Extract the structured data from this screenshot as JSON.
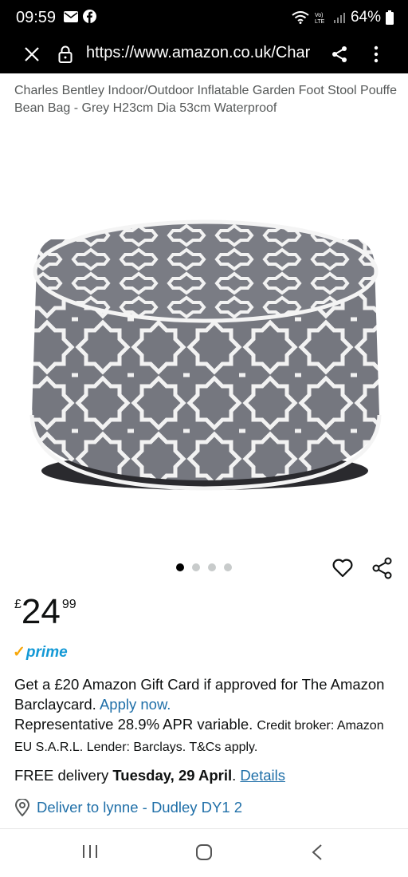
{
  "status": {
    "time": "09:59",
    "battery": "64%"
  },
  "browser": {
    "url": "https://www.amazon.co.uk/Char"
  },
  "product": {
    "title": "Charles Bentley Indoor/Outdoor Inflatable Garden Foot Stool Pouffe Bean Bag - Grey H23cm Dia 53cm Waterproof",
    "image_count": 4,
    "active_image": 1
  },
  "price": {
    "currency": "£",
    "whole": "24",
    "fraction": "99"
  },
  "prime": {
    "label": "prime"
  },
  "offer": {
    "line1": "Get a £20 Amazon Gift Card if approved for The Amazon Barclaycard.",
    "link": "Apply now.",
    "line2": "Representative 28.9% APR variable.",
    "small": "Credit broker: Amazon EU S.A.R.L. Lender: Barclays. T&Cs apply."
  },
  "delivery": {
    "prefix": "FREE delivery",
    "date": "Tuesday, 29 April",
    "link": "Details"
  },
  "deliver_to": {
    "label": "Deliver to lynne - Dudley DY1 2"
  },
  "colors": {
    "link": "#1f6fa8",
    "prime_blue": "#1399d6",
    "prime_check": "#f7a70a",
    "pouffe_grey": "#75777f"
  }
}
